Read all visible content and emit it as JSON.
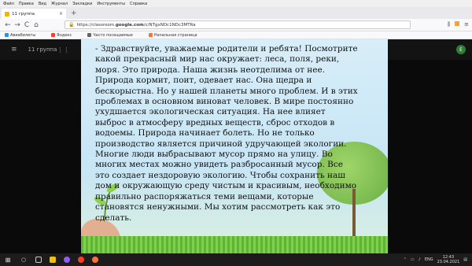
{
  "menubar": [
    "Файл",
    "Правка",
    "Вид",
    "Журнал",
    "Закладки",
    "Инструменты",
    "Справка"
  ],
  "tab": {
    "title": "11 группа",
    "close": "×"
  },
  "newtab": "+",
  "nav": {
    "back": "←",
    "forward": "→",
    "reload": "C",
    "home": "⌂"
  },
  "url": {
    "prefix": "https://classroom.",
    "domain": "google.com",
    "suffix": "/c/NTgxNDc1NDc3MTRa"
  },
  "bookmarks": [
    "Авиабилеты",
    "Яндекс",
    "Часто посещаемые",
    "Начальная страница"
  ],
  "classroom": {
    "title": "11 группа",
    "avatar": "Е"
  },
  "slide_text": "- Здравствуйте, уважаемые родители и ребята! Посмотрите какой прекрасный мир нас окружает: леса, поля, реки, моря. Это природа. Наша жизнь неотделима от нее. Природа кормит, поит, одевает нас. Она щедра и бескорыстна. Но у нашей планеты много проблем. И в этих проблемах в основном виноват человек. В мире постоянно ухудшается экологическая ситуация. На нее влияет выброс в атмосферу вредных веществ, сброс  отходов в водоемы. Природа начинает болеть. Но не только производство является причиной удручающей экологии. Многие люди выбрасывают мусор прямо на улицу. Во многих местах можно увидеть разбросанный мусор. Все это создает нездоровую экологию. Чтобы сохранить наш дом и окружающую среду чистым и красивым, необходимо правильно распоряжаться  теми вещами, которые становятся ненужными. Мы хотим рассмотреть как это сделать.",
  "taskbar": {
    "lang": "ENG",
    "time": "12:43",
    "date": "23.04.2021"
  },
  "colors": {
    "firefox": "#ff7139",
    "yandex": "#fc3f1d",
    "alice": "#8f5cf7",
    "explorer": "#f2c200"
  }
}
